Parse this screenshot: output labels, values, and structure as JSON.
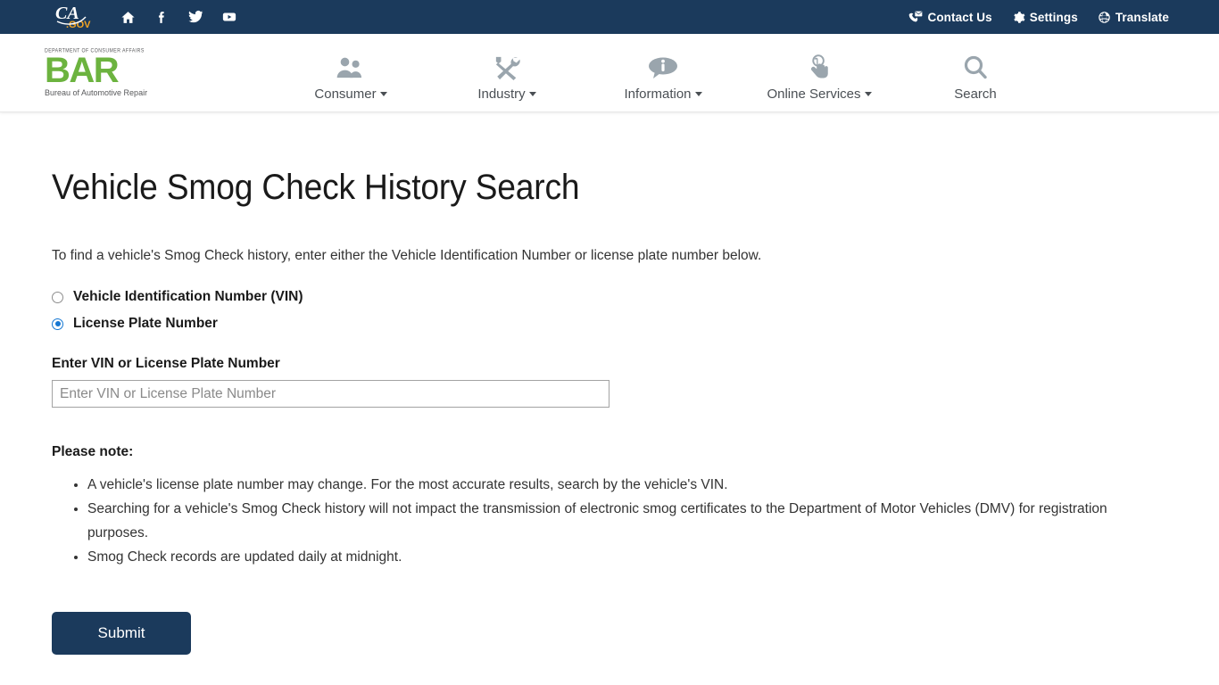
{
  "utility_bar": {
    "logo_alt": "CA.gov",
    "logo_text_main": "CA",
    "logo_text_sub": ".GOV",
    "social": [
      {
        "name": "home-icon",
        "label": "Home"
      },
      {
        "name": "facebook-icon",
        "label": "Facebook"
      },
      {
        "name": "twitter-icon",
        "label": "Twitter"
      },
      {
        "name": "youtube-icon",
        "label": "YouTube"
      }
    ],
    "links": [
      {
        "label": "Contact Us",
        "icon": "contact-icon"
      },
      {
        "label": "Settings",
        "icon": "gear-icon"
      },
      {
        "label": "Translate",
        "icon": "globe-icon"
      }
    ],
    "background_color": "#1b3a5c"
  },
  "site_header": {
    "logo": {
      "department": "DEPARTMENT OF CONSUMER AFFAIRS",
      "acronym": "BAR",
      "tagline": "Bureau of Automotive Repair",
      "color": "#6cb33f"
    },
    "nav": [
      {
        "label": "Consumer",
        "icon": "people-icon",
        "has_dropdown": true
      },
      {
        "label": "Industry",
        "icon": "tools-icon",
        "has_dropdown": true
      },
      {
        "label": "Information",
        "icon": "info-bubble-icon",
        "has_dropdown": true
      },
      {
        "label": "Online Services",
        "icon": "click-hand-icon",
        "has_dropdown": true
      },
      {
        "label": "Search",
        "icon": "search-icon",
        "has_dropdown": false
      }
    ]
  },
  "main": {
    "title": "Vehicle Smog Check History Search",
    "intro": "To find a vehicle's Smog Check history, enter either the Vehicle Identification Number or license plate number below.",
    "search_type_options": [
      {
        "label": "Vehicle Identification Number (VIN)",
        "selected": false
      },
      {
        "label": "License Plate Number",
        "selected": true
      }
    ],
    "field": {
      "label": "Enter VIN or License Plate Number",
      "placeholder": "Enter VIN or License Plate Number",
      "value": ""
    },
    "note_heading": "Please note:",
    "notes": [
      "A vehicle's license plate number may change. For the most accurate results, search by the vehicle's VIN.",
      "Searching for a vehicle's Smog Check history will not impact the transmission of electronic smog certificates to the Department of Motor Vehicles (DMV) for registration purposes.",
      "Smog Check records are updated daily at midnight."
    ],
    "submit_label": "Submit",
    "submit_color": "#1b3a5c"
  }
}
